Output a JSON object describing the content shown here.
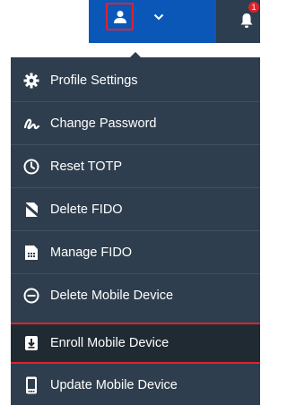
{
  "header": {
    "notification_count": "1",
    "icons": {
      "user": "user-icon",
      "dropdown": "chevron-down-icon",
      "notifications": "bell-icon"
    },
    "colors": {
      "bar_blue": "#0b57b8",
      "bar_dark": "#2c3e50",
      "highlight_red": "#e0222c"
    }
  },
  "menu": {
    "background": "#2f3e4e",
    "items": [
      {
        "label": "Profile Settings",
        "icon": "gear-icon"
      },
      {
        "label": "Change Password",
        "icon": "signature-icon"
      },
      {
        "label": "Reset TOTP",
        "icon": "clock-icon"
      },
      {
        "label": "Delete FIDO",
        "icon": "key-off-icon"
      },
      {
        "label": "Manage FIDO",
        "icon": "sim-card-icon"
      },
      {
        "label": "Delete Mobile Device",
        "icon": "minus-circle-icon"
      },
      {
        "label": "Enroll Mobile Device",
        "icon": "download-box-icon"
      },
      {
        "label": "Update Mobile Device",
        "icon": "mobile-icon"
      }
    ]
  }
}
